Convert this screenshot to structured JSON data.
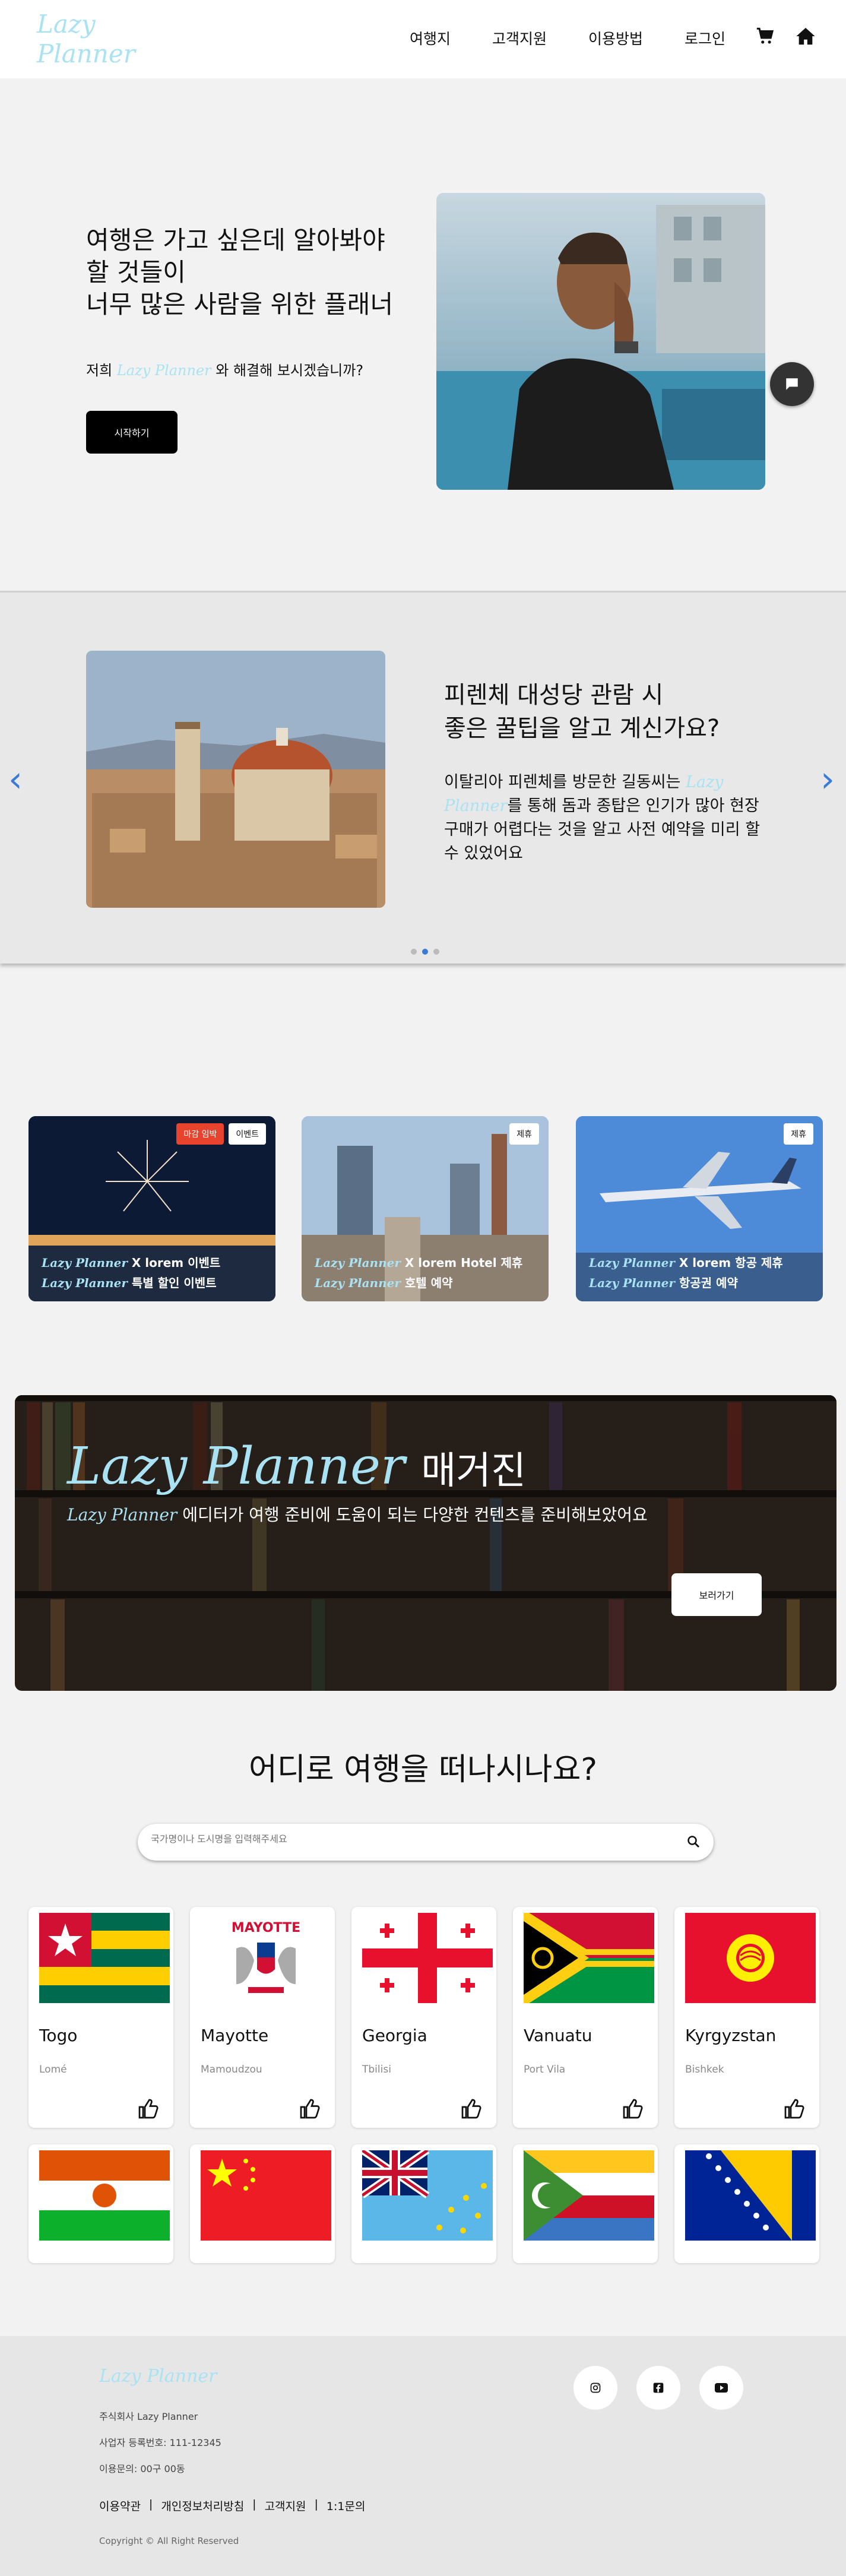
{
  "header": {
    "logo": "Lazy Planner",
    "nav": [
      "여행지",
      "고객지원",
      "이용방법",
      "로그인"
    ]
  },
  "hero": {
    "title_line1": "여행은 가고 싶은데 알아봐야",
    "title_line2": "할 것들이",
    "title_line3": "너무 많은 사람을 위한 플래너",
    "sub_prefix": "저희",
    "sub_brand": "Lazy Planner",
    "sub_suffix": "와 해결해 보시겠습니까?",
    "start_label": "시작하기"
  },
  "carousel": {
    "title_line1": "피렌체 대성당 관람 시",
    "title_line2": "좋은 꿀팁을 알고 계신가요?",
    "text_prefix": "이탈리아 피렌체를 방문한 길동씨는",
    "text_brand": "Lazy Planner",
    "text_suffix": "를 통해 돔과 종탑은 인기가 많아 현장 구매가 어렵다는 것을 알고 사전 예약을 미리 할 수 있었어요",
    "prev": "‹",
    "next": "›"
  },
  "cards": [
    {
      "tags": [
        "마감 임박",
        "이벤트"
      ],
      "brand1": "Lazy Planner",
      "line1": "X lorem 이벤트",
      "brand2": "Lazy Planner",
      "line2": "특별 할인 이벤트"
    },
    {
      "tags": [
        "제휴"
      ],
      "brand1": "Lazy Planner",
      "line1": "X lorem Hotel 제휴",
      "brand2": "Lazy Planner",
      "line2": "호텔 예약"
    },
    {
      "tags": [
        "제휴"
      ],
      "brand1": "Lazy Planner",
      "line1": "X lorem 항공 제휴",
      "brand2": "Lazy Planner",
      "line2": "항공권 예약"
    }
  ],
  "magazine": {
    "brand": "Lazy Planner",
    "title_suffix": "매거진",
    "sub_brand": "Lazy Planner",
    "sub_text": "에디터가 여행 준비에 도움이 되는 다양한 컨텐츠를 준비해보았어요",
    "button": "보러가기"
  },
  "where": {
    "title": "어디로 여행을 떠나시나요?",
    "search_placeholder": "국가명이나 도시명을 입력해주세요"
  },
  "countries": [
    {
      "name": "Togo",
      "capital": "Lomé"
    },
    {
      "name": "Mayotte",
      "capital": "Mamoudzou"
    },
    {
      "name": "Georgia",
      "capital": "Tbilisi"
    },
    {
      "name": "Vanuatu",
      "capital": "Port Vila"
    },
    {
      "name": "Kyrgyzstan",
      "capital": "Bishkek"
    }
  ],
  "flag_text": {
    "mayotte": "MAYOTTE"
  },
  "footer": {
    "logo": "Lazy Planner",
    "company": "주식회사 Lazy Planner",
    "biz_no": "사업자 등록번호: 111-12345",
    "contact": "이용문의: 00구 00동",
    "links": [
      "이용약관",
      "개인정보처리방침",
      "고객지원",
      "1:1문의"
    ],
    "copyright": "Copyright © All Right Reserved"
  },
  "colors": {
    "accent": "#a9e2f3",
    "arrow": "#3a7bd5"
  }
}
